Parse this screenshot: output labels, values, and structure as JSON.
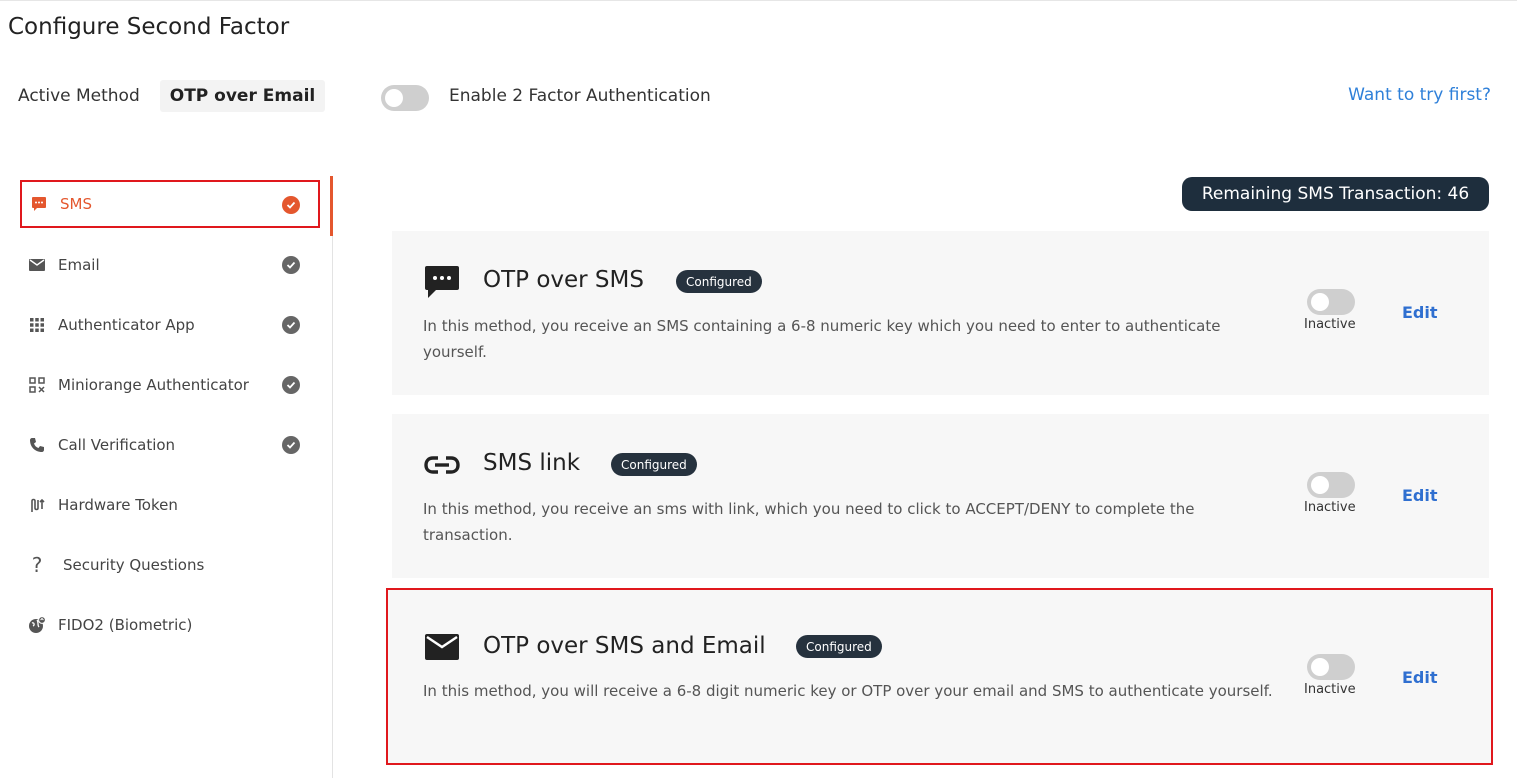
{
  "page": {
    "title": "Configure Second Factor"
  },
  "active_method": {
    "label": "Active Method",
    "value": "OTP over Email"
  },
  "two_factor": {
    "label": "Enable 2 Factor Authentication",
    "enabled": false
  },
  "try_link": "Want to try first?",
  "remaining": "Remaining SMS Transaction: 46",
  "colors": {
    "accent": "#e4572e",
    "link": "#2f80d9",
    "badge": "#26323e",
    "highlight": "#e0181d"
  },
  "sidebar": {
    "items": [
      {
        "label": "SMS",
        "icon": "sms-icon",
        "checked": true,
        "active": true
      },
      {
        "label": "Email",
        "icon": "email-icon",
        "checked": true
      },
      {
        "label": "Authenticator App",
        "icon": "grid-icon",
        "checked": true
      },
      {
        "label": "Miniorange Authenticator",
        "icon": "qr-code-icon",
        "checked": true
      },
      {
        "label": "Call Verification",
        "icon": "phone-icon",
        "checked": true
      },
      {
        "label": "Hardware Token",
        "icon": "token-icon",
        "checked": false
      },
      {
        "label": "Security Questions",
        "icon": "question-icon",
        "checked": false
      },
      {
        "label": "FIDO2 (Biometric)",
        "icon": "fingerprint-globe-icon",
        "checked": false
      }
    ]
  },
  "methods": [
    {
      "title": "OTP over SMS",
      "badge": "Configured",
      "icon": "sms-bubble-icon",
      "description": "In this method, you receive an SMS containing a 6-8 numeric key which you need to enter to authenticate yourself.",
      "status": "Inactive",
      "edit": "Edit"
    },
    {
      "title": "SMS link",
      "badge": "Configured",
      "icon": "link-icon",
      "description": "In this method, you receive an sms with link, which you need to click to ACCEPT/DENY to complete the transaction.",
      "status": "Inactive",
      "edit": "Edit"
    },
    {
      "title": "OTP over SMS and Email",
      "badge": "Configured",
      "icon": "envelope-icon",
      "description": "In this method, you will receive a 6-8 digit numeric key or OTP over your email and SMS to authenticate yourself.",
      "status": "Inactive",
      "edit": "Edit"
    }
  ]
}
